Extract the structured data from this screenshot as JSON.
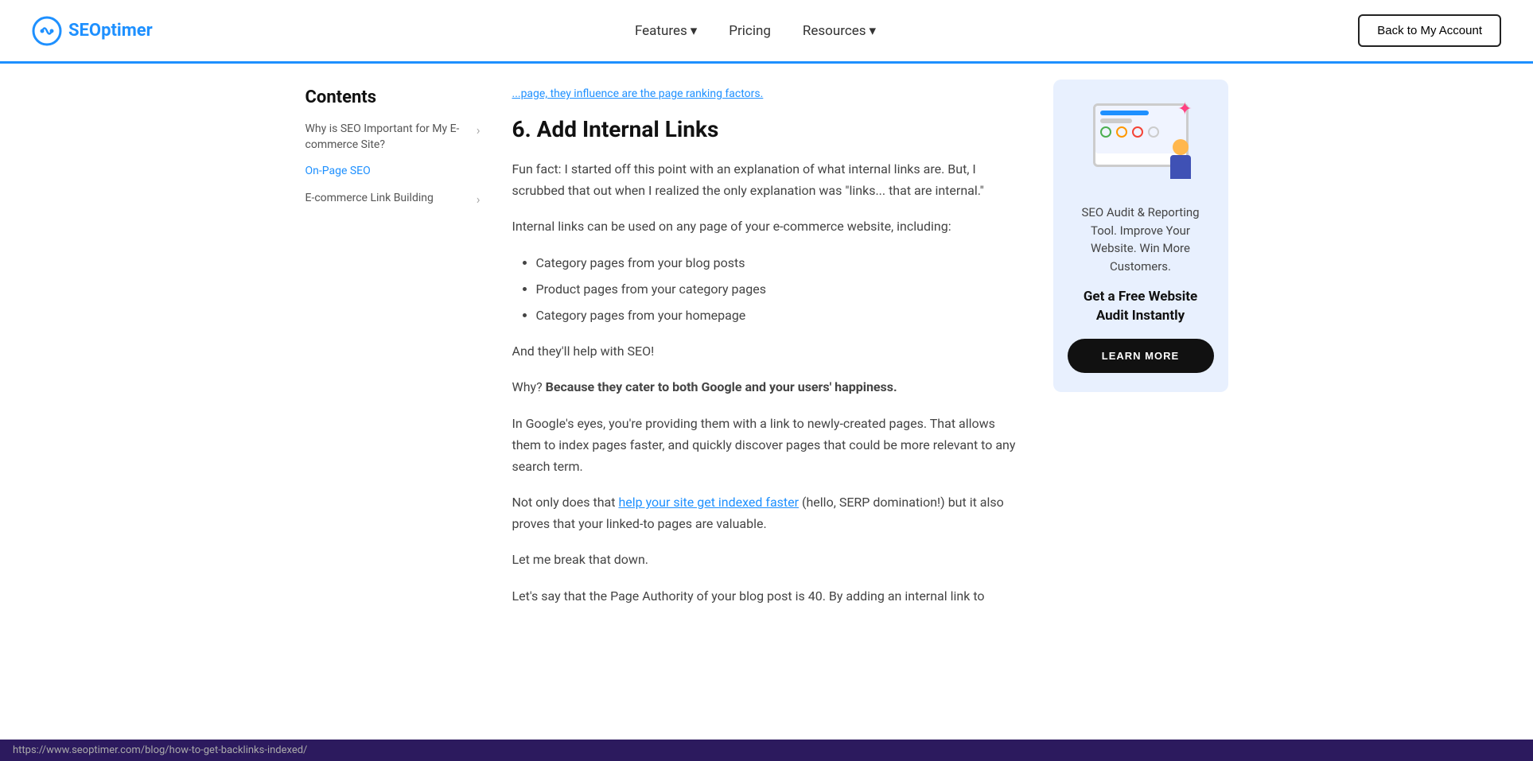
{
  "header": {
    "logo_text_se": "SE",
    "logo_text_optimer": "Optimer",
    "nav": {
      "features_label": "Features",
      "pricing_label": "Pricing",
      "resources_label": "Resources"
    },
    "back_btn_label": "Back to My Account"
  },
  "sidebar": {
    "contents_title": "Contents",
    "items": [
      {
        "label": "Why is SEO Important for My E-commerce Site?",
        "active": false,
        "has_arrow": true
      },
      {
        "label": "On-Page SEO",
        "active": true,
        "has_arrow": false
      },
      {
        "label": "E-commerce Link Building",
        "active": false,
        "has_arrow": true
      }
    ]
  },
  "article": {
    "partial_top_text": "...page, they influence are the page ranking factors.",
    "section_heading": "6. Add Internal Links",
    "paragraphs": [
      "Fun fact: I started off this point with an explanation of what internal links are. But, I scrubbed that out when I realized the only explanation was \"links... that are internal.\"",
      "Internal links can be used on any page of your e-commerce website, including:",
      "",
      "And they'll help with SEO!",
      "Why? Because they cater to both Google and your users' happiness.",
      "In Google's eyes, you're providing them with a link to newly-created pages. That allows them to index pages faster, and quickly discover pages that could be more relevant to any search term.",
      "Not only does that {link} (hello, SERP domination!) but it also proves that your linked-to pages are valuable.",
      "Let me break that down.",
      "Let's say that the Page Authority of your blog post is 40. By adding an internal link to"
    ],
    "link_text": "help your site get indexed faster",
    "link_url": "https://www.seoptimer.com/blog/how-to-get-backlinks-indexed/",
    "bullet_items": [
      "Category pages from your blog posts",
      "Product pages from your category pages",
      "Category pages from your homepage"
    ],
    "why_bold": "Because they cater to both Google and your users' happiness."
  },
  "cta_card": {
    "description": "SEO Audit & Reporting Tool. Improve Your Website. Win More Customers.",
    "headline": "Get a Free Website Audit Instantly",
    "btn_label": "LEARN MORE"
  },
  "status_bar": {
    "url": "https://www.seoptimer.com/blog/how-to-get-backlinks-indexed/"
  }
}
